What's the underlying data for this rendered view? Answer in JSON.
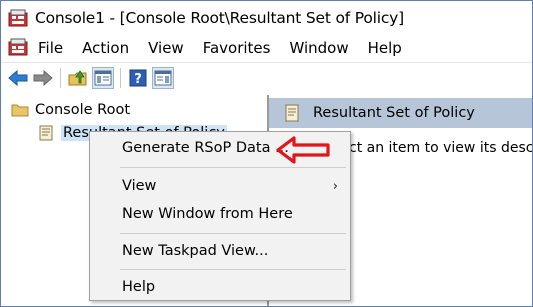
{
  "window": {
    "title": "Console1 - [Console Root\\Resultant Set of Policy]"
  },
  "menubar": {
    "items": [
      "File",
      "Action",
      "View",
      "Favorites",
      "Window",
      "Help"
    ]
  },
  "toolbar": {
    "buttons": [
      "back-arrow-icon",
      "forward-arrow-icon",
      "up-folder-icon",
      "show-hide-tree-icon",
      "help-icon",
      "action-pane-icon"
    ]
  },
  "tree": {
    "root_label": "Console Root",
    "child_label": "Resultant Set of Policy"
  },
  "right_pane": {
    "header": "Resultant Set of Policy",
    "hint": "Select an item to view its description."
  },
  "context_menu": {
    "items": [
      {
        "label": "Generate RSoP Data ..."
      },
      {
        "label": "View",
        "submenu_glyph": "›"
      },
      {
        "label": "New Window from Here"
      },
      {
        "label": "New Taskpad View..."
      },
      {
        "label": "Help"
      }
    ]
  },
  "colors": {
    "tree_selection": "#cce4f7",
    "pane_header": "#b6c6d8",
    "callout": "#e3141b",
    "frame_border": "#5b7fb0"
  }
}
